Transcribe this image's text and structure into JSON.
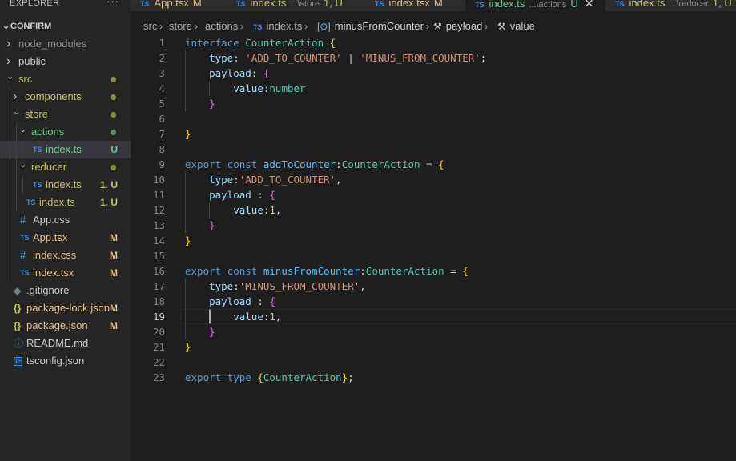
{
  "sidebar": {
    "title": "EXPLORER",
    "more": "···",
    "project": "CONFIRM",
    "tree": [
      {
        "label": "node_modules",
        "kind": "folder",
        "depth": 0,
        "open": false,
        "color": "#8b8b8b"
      },
      {
        "label": "public",
        "kind": "folder",
        "depth": 0,
        "open": false,
        "color": "#cccccc"
      },
      {
        "label": "src",
        "kind": "folder",
        "depth": 0,
        "open": true,
        "color": "#c5c06c",
        "dot": "#8c8c30"
      },
      {
        "label": "components",
        "kind": "folder",
        "depth": 1,
        "open": false,
        "color": "#c5c06c",
        "dot": "#8c8c30"
      },
      {
        "label": "store",
        "kind": "folder",
        "depth": 1,
        "open": true,
        "color": "#c5c06c",
        "dot": "#8c8c30"
      },
      {
        "label": "actions",
        "kind": "folder",
        "depth": 2,
        "open": true,
        "color": "#73c991",
        "dot": "#5a8a6a"
      },
      {
        "label": "index.ts",
        "kind": "ts",
        "depth": 3,
        "color": "#73c991",
        "badge": "U",
        "badgeColor": "#73c991",
        "selected": true
      },
      {
        "label": "reducer",
        "kind": "folder",
        "depth": 2,
        "open": true,
        "color": "#c5c06c",
        "dot": "#8c8c30"
      },
      {
        "label": "index.ts",
        "kind": "ts",
        "depth": 3,
        "color": "#c5c06c",
        "badge": "1, U",
        "badgeColor": "#c5c06c"
      },
      {
        "label": "index.ts",
        "kind": "ts",
        "depth": 2,
        "color": "#c5c06c",
        "badge": "1, U",
        "badgeColor": "#c5c06c"
      },
      {
        "label": "App.css",
        "kind": "css",
        "depth": 1,
        "color": "#cccccc"
      },
      {
        "label": "App.tsx",
        "kind": "ts",
        "depth": 1,
        "color": "#e2c08d",
        "badge": "M",
        "badgeColor": "#e2c08d"
      },
      {
        "label": "index.css",
        "kind": "css",
        "depth": 1,
        "color": "#e2c08d",
        "badge": "M",
        "badgeColor": "#e2c08d"
      },
      {
        "label": "index.tsx",
        "kind": "ts",
        "depth": 1,
        "color": "#e2c08d",
        "badge": "M",
        "badgeColor": "#e2c08d"
      },
      {
        "label": ".gitignore",
        "kind": "git",
        "depth": 0,
        "color": "#cccccc"
      },
      {
        "label": "package-lock.json",
        "kind": "json",
        "depth": 0,
        "color": "#e2c08d",
        "badge": "M",
        "badgeColor": "#e2c08d"
      },
      {
        "label": "package.json",
        "kind": "json",
        "depth": 0,
        "color": "#e2c08d",
        "badge": "M",
        "badgeColor": "#e2c08d"
      },
      {
        "label": "README.md",
        "kind": "info",
        "depth": 0,
        "color": "#cccccc"
      },
      {
        "label": "tsconfig.json",
        "kind": "tsconf",
        "depth": 0,
        "color": "#cccccc"
      }
    ]
  },
  "tabs": [
    {
      "label": "App.tsx",
      "desc": "",
      "badge": "M",
      "color": "#e2c08d",
      "active": false
    },
    {
      "label": "index.ts",
      "desc": "...\\store",
      "badge": "1, U",
      "color": "#c5c06c",
      "active": false
    },
    {
      "label": "index.tsx",
      "desc": "",
      "badge": "M",
      "color": "#e2c08d",
      "active": false
    },
    {
      "label": "index.ts",
      "desc": "...\\actions",
      "badge": "U",
      "color": "#73c991",
      "active": true,
      "close": "✕"
    },
    {
      "label": "index.ts",
      "desc": "...\\reducer",
      "badge": "1, U",
      "color": "#c5c06c",
      "active": false
    }
  ],
  "breadcrumb": {
    "items": [
      "src",
      "store",
      "actions",
      "index.ts",
      "minusFromCounter",
      "payload",
      "value"
    ],
    "icons": [
      "",
      "",
      "",
      "ts-file-icon",
      "variable-icon",
      "wrench-icon",
      "wrench-icon"
    ]
  },
  "editor": {
    "current_line": 19,
    "lines": [
      [
        [
          "interface ",
          "kw"
        ],
        [
          "CounterAction ",
          "ty"
        ],
        [
          "{",
          "b1"
        ]
      ],
      [
        [
          "    ",
          ""
        ],
        [
          "type",
          "prop"
        ],
        [
          ": ",
          "pun"
        ],
        [
          "'ADD_TO_COUNTER'",
          "str"
        ],
        [
          " | ",
          "pun"
        ],
        [
          "'MINUS_FROM_COUNTER'",
          "str"
        ],
        [
          ";",
          "pun"
        ]
      ],
      [
        [
          "    ",
          ""
        ],
        [
          "payload",
          "prop"
        ],
        [
          ": ",
          "pun"
        ],
        [
          "{",
          "b2"
        ]
      ],
      [
        [
          "        ",
          ""
        ],
        [
          "value",
          "prop"
        ],
        [
          ":",
          "pun"
        ],
        [
          "number",
          "ty"
        ]
      ],
      [
        [
          "    ",
          ""
        ],
        [
          "}",
          "b2"
        ]
      ],
      [],
      [
        [
          "}",
          "b1"
        ]
      ],
      [],
      [
        [
          "export ",
          "kw"
        ],
        [
          "const ",
          "kw"
        ],
        [
          "addToCounter",
          "var"
        ],
        [
          ":",
          "pun"
        ],
        [
          "CounterAction",
          "ty"
        ],
        [
          " = ",
          "pun"
        ],
        [
          "{",
          "b1"
        ]
      ],
      [
        [
          "    ",
          ""
        ],
        [
          "type",
          "prop"
        ],
        [
          ":",
          "pun"
        ],
        [
          "'ADD_TO_COUNTER'",
          "str"
        ],
        [
          ",",
          "pun"
        ]
      ],
      [
        [
          "    ",
          ""
        ],
        [
          "payload",
          "prop"
        ],
        [
          " : ",
          "pun"
        ],
        [
          "{",
          "b2"
        ]
      ],
      [
        [
          "        ",
          ""
        ],
        [
          "value",
          "prop"
        ],
        [
          ":",
          "pun"
        ],
        [
          "1",
          "num"
        ],
        [
          ",",
          "pun"
        ]
      ],
      [
        [
          "    ",
          ""
        ],
        [
          "}",
          "b2"
        ]
      ],
      [
        [
          "}",
          "b1"
        ]
      ],
      [],
      [
        [
          "export ",
          "kw"
        ],
        [
          "const ",
          "kw"
        ],
        [
          "minusFromCounter",
          "var"
        ],
        [
          ":",
          "pun"
        ],
        [
          "CounterAction",
          "ty"
        ],
        [
          " = ",
          "pun"
        ],
        [
          "{",
          "b1"
        ]
      ],
      [
        [
          "    ",
          ""
        ],
        [
          "type",
          "prop"
        ],
        [
          ":",
          "pun"
        ],
        [
          "'MINUS_FROM_COUNTER'",
          "str"
        ],
        [
          ",",
          "pun"
        ]
      ],
      [
        [
          "    ",
          ""
        ],
        [
          "payload",
          "prop"
        ],
        [
          " : ",
          "pun"
        ],
        [
          "{",
          "b2"
        ]
      ],
      [
        [
          "        ",
          ""
        ],
        [
          "value",
          "prop"
        ],
        [
          ":",
          "pun"
        ],
        [
          "1",
          "num"
        ],
        [
          ",",
          "pun"
        ]
      ],
      [
        [
          "    ",
          ""
        ],
        [
          "}",
          "b2"
        ]
      ],
      [
        [
          "}",
          "b1"
        ]
      ],
      [],
      [
        [
          "export ",
          "kw"
        ],
        [
          "type ",
          "kw"
        ],
        [
          "{",
          "b1"
        ],
        [
          "CounterAction",
          "ty"
        ],
        [
          "}",
          "b1"
        ],
        [
          ";",
          "pun"
        ]
      ]
    ]
  }
}
